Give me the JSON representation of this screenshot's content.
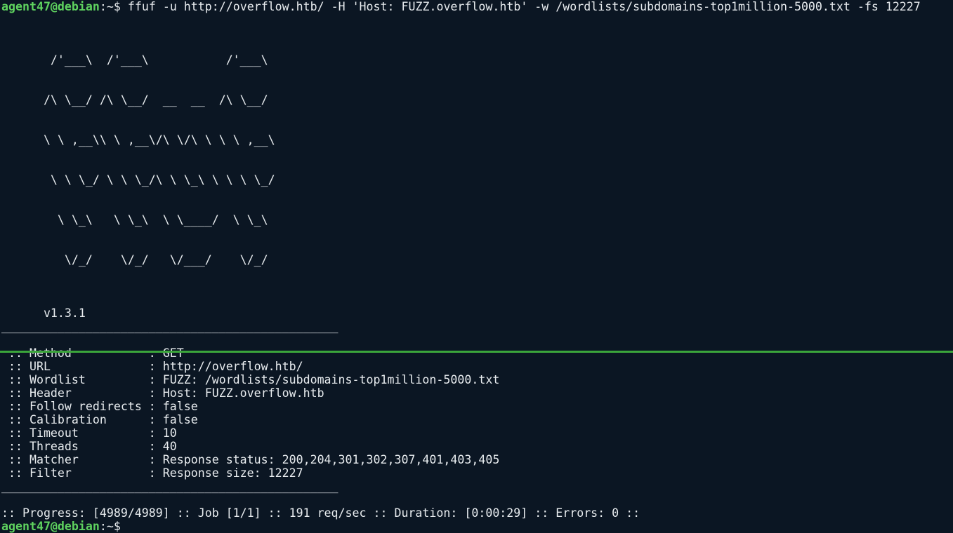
{
  "prompt": {
    "user": "agent47@debian",
    "sep": ":",
    "path": "~",
    "symbol": "$"
  },
  "command": "ffuf -u http://overflow.htb/ -H 'Host: FUZZ.overflow.htb' -w /wordlists/subdomains-top1million-5000.txt -fs 12227",
  "banner": [
    "       /'___\\  /'___\\           /'___\\",
    "      /\\ \\__/ /\\ \\__/  __  __  /\\ \\__/",
    "      \\ \\ ,__\\\\ \\ ,__\\/\\ \\/\\ \\ \\ \\ ,__\\",
    "       \\ \\ \\_/ \\ \\ \\_/\\ \\ \\_\\ \\ \\ \\ \\_/",
    "        \\ \\_\\   \\ \\_\\  \\ \\____/  \\ \\_\\",
    "         \\/_/    \\/_/   \\/___/    \\/_/"
  ],
  "version": "      v1.3.1",
  "rule": "________________________________________________",
  "config": [
    {
      "label": " :: Method           ",
      "value": ": GET"
    },
    {
      "label": " :: URL              ",
      "value": ": http://overflow.htb/"
    },
    {
      "label": " :: Wordlist         ",
      "value": ": FUZZ: /wordlists/subdomains-top1million-5000.txt"
    },
    {
      "label": " :: Header           ",
      "value": ": Host: FUZZ.overflow.htb"
    },
    {
      "label": " :: Follow redirects ",
      "value": ": false"
    },
    {
      "label": " :: Calibration      ",
      "value": ": false"
    },
    {
      "label": " :: Timeout          ",
      "value": ": 10"
    },
    {
      "label": " :: Threads          ",
      "value": ": 40"
    },
    {
      "label": " :: Matcher          ",
      "value": ": Response status: 200,204,301,302,307,401,403,405"
    },
    {
      "label": " :: Filter           ",
      "value": ": Response size: 12227"
    }
  ],
  "progress": ":: Progress: [4989/4989] :: Job [1/1] :: 191 req/sec :: Duration: [0:00:29] :: Errors: 0 ::",
  "colors": {
    "background": "#0b1623",
    "prompt_user": "#5fd35f",
    "text": "#e8ecef",
    "status_bar": "#3ba53b"
  }
}
